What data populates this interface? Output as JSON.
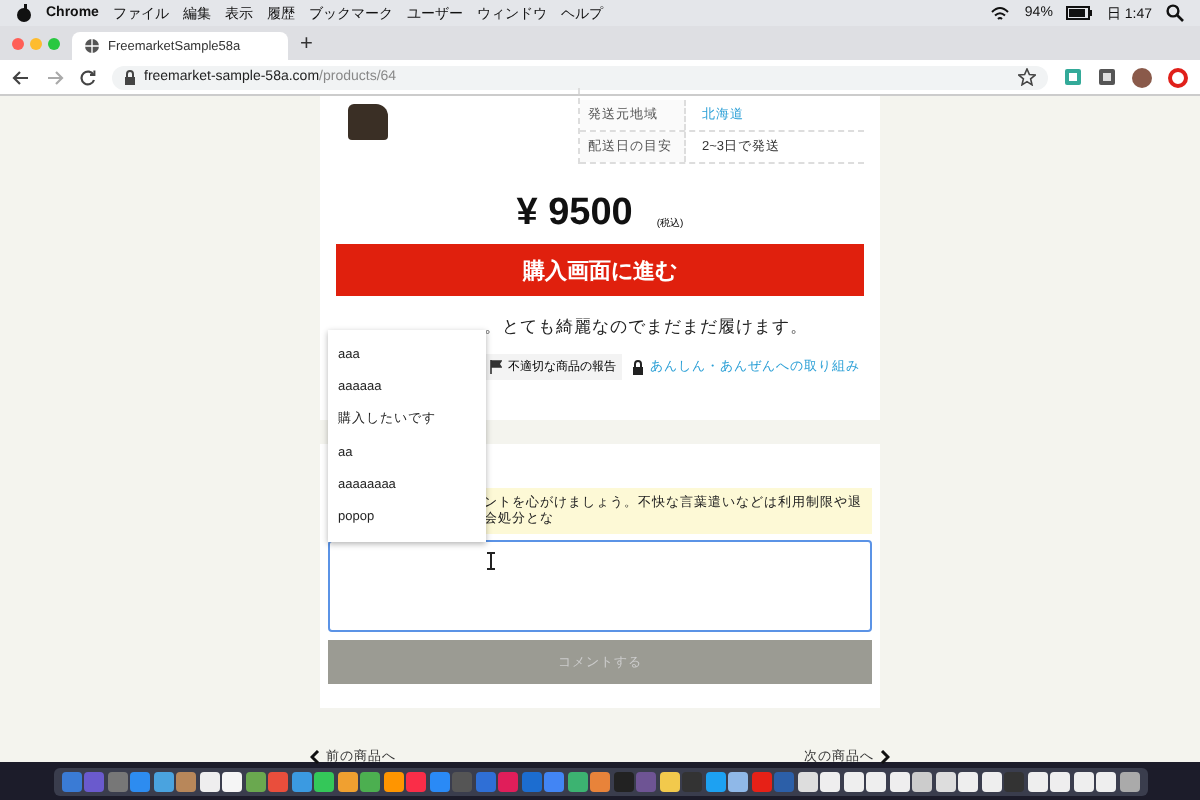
{
  "menu_bar": {
    "app": "Chrome",
    "items": [
      "ファイル",
      "編集",
      "表示",
      "履歴",
      "ブックマーク",
      "ユーザー",
      "ウィンドウ",
      "ヘルプ"
    ],
    "battery": "94%",
    "clock": "日 1:47"
  },
  "tabs": [
    {
      "label": "FreemarketSample58a",
      "selected": true
    }
  ],
  "new_tab": "+",
  "address": {
    "domain": "freemarket-sample-58a.com",
    "path": "/products/64"
  },
  "details": [
    {
      "label": "発送元地域",
      "value": "北海道",
      "kind": "link"
    },
    {
      "label": "配送日の目安",
      "value": "2~3日で発送",
      "kind": "text"
    }
  ],
  "price": {
    "amount": "¥ 9500",
    "tax": "(税込)"
  },
  "buy_button": "購入画面に進む",
  "description": "。とても綺麗なのでまだまだ履けます。",
  "report_button": "不適切な商品の報告",
  "safety_link": "あんしん・あんぜんへの取り組み",
  "comment_notice": "ントを心がけましょう。不快な言葉遣いなどは利用制限や退会処分とな",
  "comment_button": {
    "label": "コメントする",
    "disabled": true
  },
  "autocomplete": [
    {
      "label": "aaa"
    },
    {
      "label": "aaaaaa"
    },
    {
      "label": "購入したいです"
    },
    {
      "label": "aa"
    },
    {
      "label": "aaaaaaaa"
    },
    {
      "label": "popop"
    }
  ],
  "prev_link": "前の商品へ",
  "next_link": "次の商品へ"
}
